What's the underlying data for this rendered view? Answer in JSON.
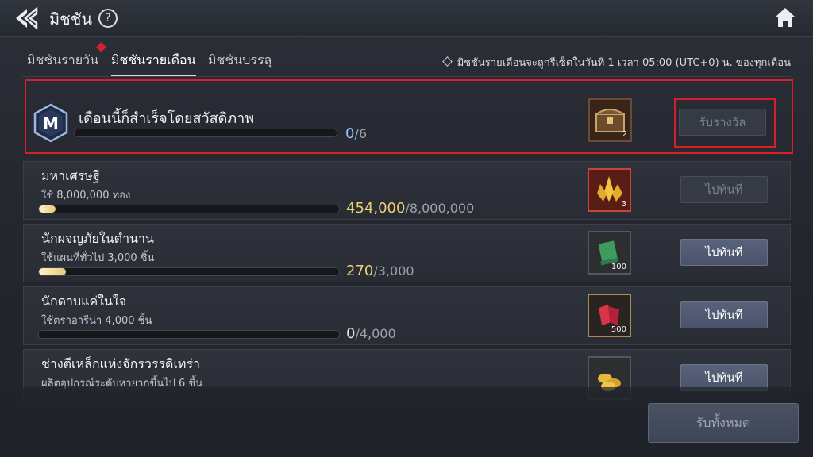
{
  "header": {
    "title": "มิชชัน",
    "help_icon": "?",
    "back_icon": "back-arrow-icon",
    "home_icon": "home-icon"
  },
  "tabs": [
    {
      "label": "มิชชันรายวัน",
      "active": false,
      "has_alert": false
    },
    {
      "label": "มิชชันรายเดือน",
      "active": true,
      "has_alert": true
    },
    {
      "label": "มิชชันบรรลุ",
      "active": false,
      "has_alert": false
    }
  ],
  "notice": "มิชชันรายเดือนจะถูกรีเซ็ตในวันที่ 1 เวลา 05:00 (UTC+0) น. ของทุกเดือน",
  "monthly": {
    "badge_letter": "M",
    "title": "เดือนนี้ก็สำเร็จโดยสวัสดิภาพ",
    "current": "0",
    "total": "/6",
    "progress": 0,
    "reward_icon": "treasure-chest-icon",
    "reward_count": "2",
    "claim_label": "รับรางวัล"
  },
  "missions": [
    {
      "title": "มหาเศรษฐี",
      "desc": "ใช้ 8,000,000 ทอง",
      "current": "454,000",
      "total": "/8,000,000",
      "progress": 0.0568,
      "reward_icon": "gold-crystal-icon",
      "reward_count": "3",
      "button": "ไปทันที",
      "button_enabled": false
    },
    {
      "title": "นักผจญภัยในตำนาน",
      "desc": "ใช้แผนที่ทั่วไป 3,000 ชิ้น",
      "current": "270",
      "total": "/3,000",
      "progress": 0.09,
      "reward_icon": "scroll-icon",
      "reward_count": "100",
      "button": "ไปทันที",
      "button_enabled": true
    },
    {
      "title": "นักดาบแค่ในใจ",
      "desc": "ใช้ตราอารีน่า 4,000 ชิ้น",
      "current": "0",
      "total": "/4,000",
      "progress": 0,
      "reward_icon": "red-gem-icon",
      "reward_count": "500",
      "button": "ไปทันที",
      "button_enabled": true
    },
    {
      "title": "ช่างตีเหล็กแห่งจักรวรรดิเทร่า",
      "desc": "ผลิตอุปกรณ์ระดับหายากขึ้นไป 6 ชิ้น",
      "button": "ไปทันที",
      "button_enabled": true,
      "reward_icon": "gold-coins-icon"
    }
  ],
  "claim_all_label": "รับทั้งหมด"
}
